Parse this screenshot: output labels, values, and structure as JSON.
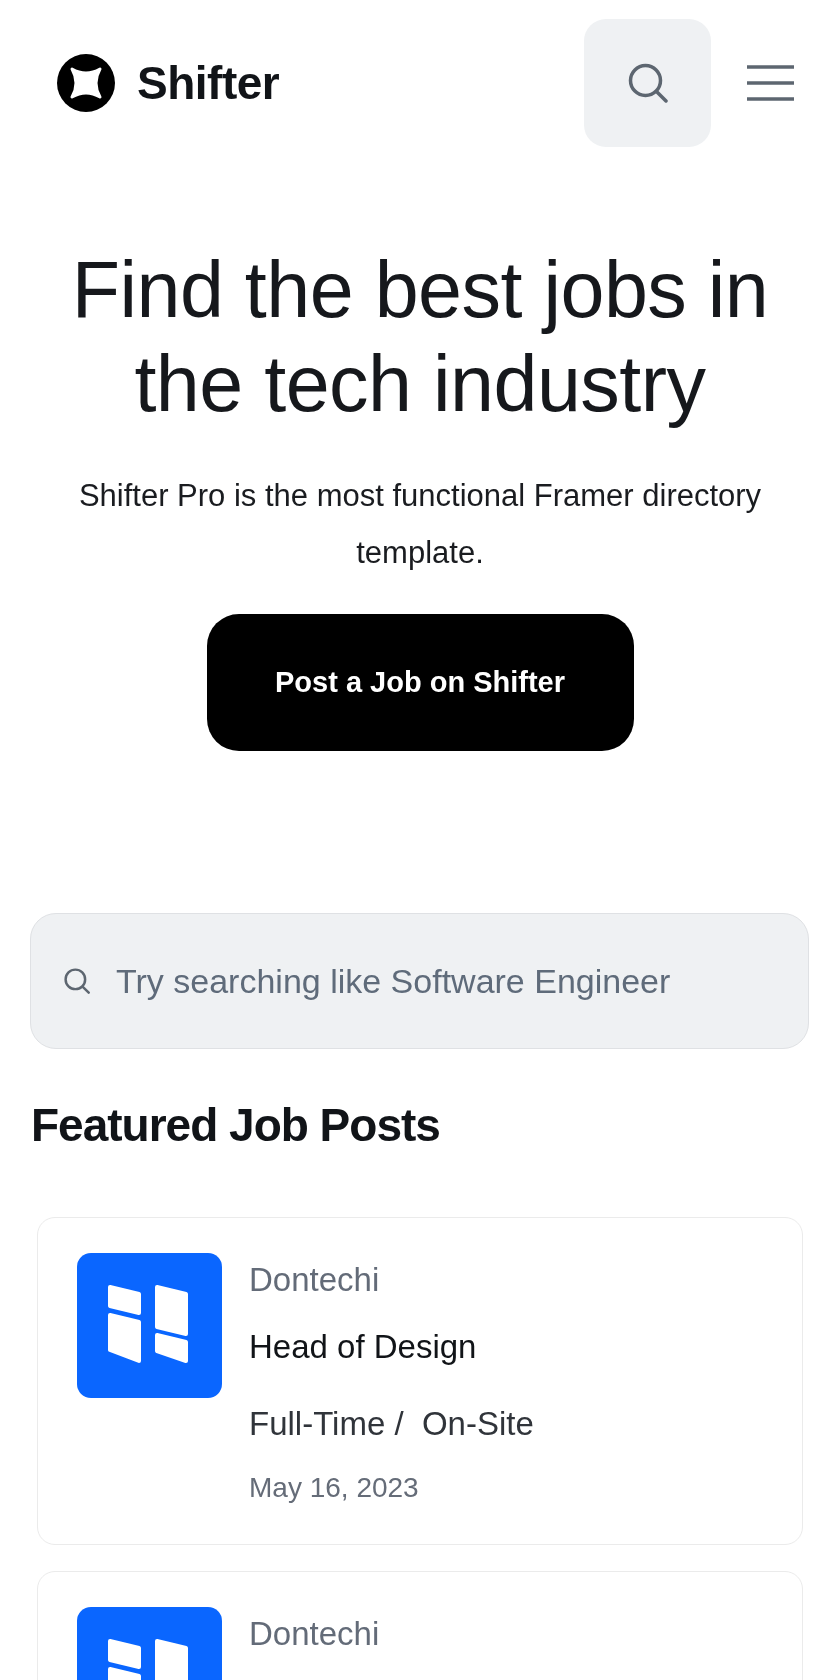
{
  "header": {
    "brand": "Shifter"
  },
  "hero": {
    "title": "Find the best jobs in the tech industry",
    "subtitle": "Shifter Pro is the most functional Framer directory template.",
    "cta": "Post a Job on Shifter"
  },
  "search": {
    "placeholder": "Try searching like Software Engineer"
  },
  "featured": {
    "heading": "Featured Job Posts",
    "jobs": [
      {
        "company": "Dontechi",
        "title": "Head of Design",
        "terms": "Full-Time /  On-Site",
        "date": "May 16, 2023"
      },
      {
        "company": "Dontechi"
      }
    ]
  }
}
